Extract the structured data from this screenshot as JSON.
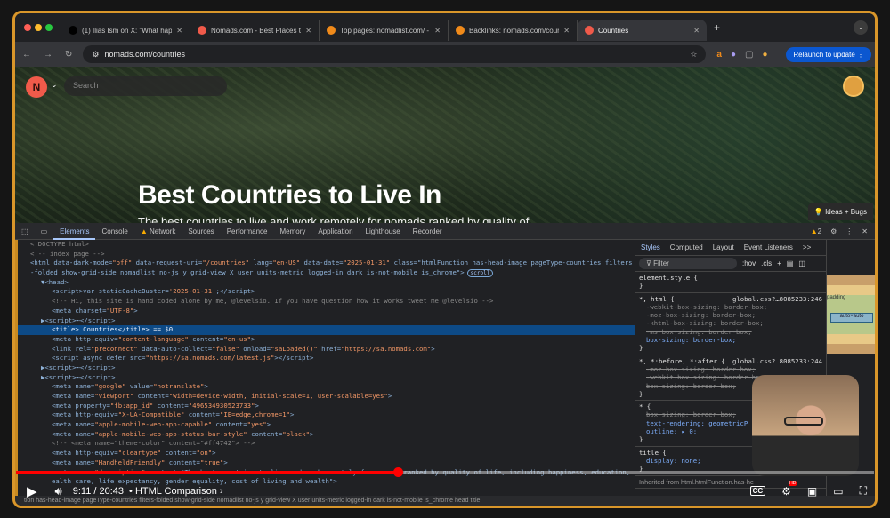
{
  "browser": {
    "tabs": [
      {
        "label": "(1) Ilias Ism on X: \"What happ",
        "icon": "x-icon",
        "color": "#000000"
      },
      {
        "label": "Nomads.com - Best Places to",
        "icon": "nomads-icon",
        "color": "#f05a4a"
      },
      {
        "label": "Top pages: nomadlist.com/ -",
        "icon": "ahrefs-icon",
        "color": "#f08a1a"
      },
      {
        "label": "Backlinks: nomads.com/coun",
        "icon": "ahrefs-icon",
        "color": "#f08a1a"
      },
      {
        "label": "Countries",
        "icon": "nomads-icon",
        "color": "#f05a4a",
        "active": true
      }
    ],
    "url": "nomads.com/countries",
    "relaunch": "Relaunch to update"
  },
  "page": {
    "search_placeholder": "Search",
    "title": "Best Countries to Live In",
    "subtitle": "The best countries to live and work remotely for nomads ranked by quality of",
    "ideas": "Ideas + Bugs"
  },
  "devtools": {
    "tabs": [
      "Elements",
      "Console",
      "Network",
      "Sources",
      "Performance",
      "Memory",
      "Application",
      "Lighthouse",
      "Recorder"
    ],
    "warnings": "2",
    "lines": [
      {
        "i": 0,
        "k": "cm",
        "t": "<!DOCTYPE html>"
      },
      {
        "i": 0,
        "k": "cm",
        "t": "<!-- index page -->"
      },
      {
        "i": 0,
        "t": "<html data-dark-mode=\"off\" data-request-uri=\"/countries\" lang=\"en-US\" data-date=\"2025-01-31\" class=\"htmlFunction has-head-image pageType-countries filters"
      },
      {
        "i": 0,
        "t": "-folded show-grid-side nomadlist no-js y grid-view X user units-metric logged-in dark is-not-mobile is_chrome\">",
        "badge": "scroll"
      },
      {
        "i": 1,
        "t": "▼<head>"
      },
      {
        "i": 2,
        "t": "<script>var staticCacheBuster='2025-01-31';</script>"
      },
      {
        "i": 2,
        "k": "cm",
        "t": "<!-- Hi, this site is hand coded alone by me, @levelsio. If you have question how it works tweet me @levelsio -->"
      },
      {
        "i": 2,
        "t": "<meta charset=\"UTF-8\">"
      },
      {
        "i": 1,
        "t": "▶<script>⋯</script>"
      },
      {
        "i": 2,
        "sel": true,
        "t": "<title> Countries</title> == $0"
      },
      {
        "i": 2,
        "t": "<meta http-equiv=\"content-language\" content=\"en-us\">"
      },
      {
        "i": 2,
        "t": "<link rel=\"preconnect\" data-auto-collect=\"false\" onload=\"saLoaded()\" href=\"https://sa.nomads.com\">"
      },
      {
        "i": 2,
        "t": "<script async defer src=\"https://sa.nomads.com/latest.js\"></script>"
      },
      {
        "i": 1,
        "t": "▶<script>⋯</script>"
      },
      {
        "i": 1,
        "t": "▶<script>⋯</script>"
      },
      {
        "i": 2,
        "t": "<meta name=\"google\" value=\"notranslate\">"
      },
      {
        "i": 2,
        "t": "<meta name=\"viewport\" content=\"width=device-width, initial-scale=1, user-scalable=yes\">"
      },
      {
        "i": 2,
        "t": "<meta property=\"fb:app_id\" content=\"496534930523733\">"
      },
      {
        "i": 2,
        "t": "<meta http-equiv=\"X-UA-Compatible\" content=\"IE=edge,chrome=1\">"
      },
      {
        "i": 2,
        "t": "<meta name=\"apple-mobile-web-app-capable\" content=\"yes\">"
      },
      {
        "i": 2,
        "t": "<meta name=\"apple-mobile-web-app-status-bar-style\" content=\"black\">"
      },
      {
        "i": 2,
        "k": "cm",
        "t": "<!-- <meta name=\"theme-color\" content=\"#ff4742\"> -->"
      },
      {
        "i": 2,
        "t": "<meta http-equiv=\"cleartype\" content=\"on\">"
      },
      {
        "i": 2,
        "t": "<meta name=\"HandheldFriendly\" content=\"true\">"
      },
      {
        "i": 2,
        "t": "<meta name=\"description\" content=\"The best countries to live and work remotely for nomads ranked by quality of life, including happiness, education, h"
      },
      {
        "i": 2,
        "t": "ealth care, life expectancy, gender equality, cost of living and wealth\">"
      }
    ],
    "breadcrumb": "tion has-head-image pageType-countries filters-folded show-grid-side nomadlist no-js y grid-view X user units-metric logged-in dark is-not-mobile is_chrome    head    title",
    "styles": {
      "tabs": [
        "Styles",
        "Computed",
        "Layout",
        "Event Listeners",
        ">>"
      ],
      "filter": "Filter",
      "hov": ":hov",
      "cls": ".cls",
      "rules": [
        {
          "sel": "element.style {",
          "src": "",
          "props": []
        },
        {
          "sel": "*, html {",
          "src": "global.css?…8085233:246",
          "props": [
            {
              "t": "-webkit-box-sizing: border-box;",
              "s": true
            },
            {
              "t": "-moz-box-sizing: border-box;",
              "s": true
            },
            {
              "t": "-khtml-box-sizing: border-box;",
              "s": true
            },
            {
              "t": "-ms-box-sizing: border-box;",
              "s": true
            },
            {
              "t": "box-sizing: border-box;",
              "s": false
            }
          ]
        },
        {
          "sel": "*, *:before, *:after {",
          "src": "global.css?…8085233:244",
          "props": [
            {
              "t": "-moz-box-sizing: border-box;",
              "s": true
            },
            {
              "t": "-webkit-box-sizing: border-box;",
              "s": true
            },
            {
              "t": "box-sizing: border-box;",
              "s": true
            }
          ]
        },
        {
          "sel": "* {",
          "src": "global",
          "props": [
            {
              "t": "box-sizing: border-box;",
              "s": true
            },
            {
              "t": "text-rendering: geometricP",
              "s": false
            },
            {
              "t": "outline: ▸ 0;",
              "s": false
            }
          ]
        },
        {
          "sel": "title {",
          "src": "use",
          "props": [
            {
              "t": "display: none;",
              "s": false
            }
          ]
        }
      ],
      "inherited": "Inherited from html.htmlFunction.has-he"
    },
    "box_model": {
      "padding": "padding",
      "content": "auto×auto",
      "dash": "–"
    }
  },
  "video": {
    "time": "9:11 / 20:43",
    "chapter": "HTML Comparison",
    "progress": 0.445,
    "cc": "CC",
    "hd": "HD"
  }
}
